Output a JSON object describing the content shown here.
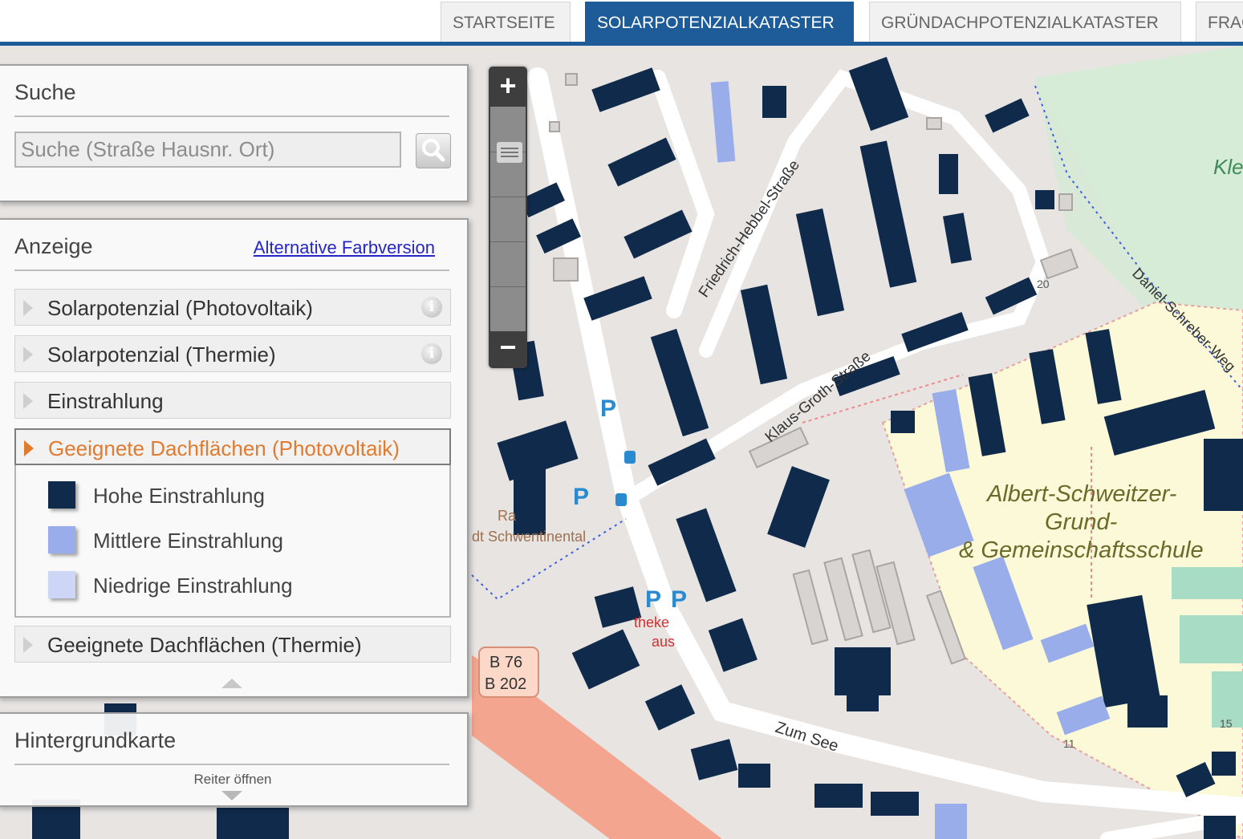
{
  "nav": {
    "tabs": [
      {
        "label": "STARTSEITE",
        "active": false
      },
      {
        "label": "SOLARPOTENZIALKATASTER",
        "active": true
      },
      {
        "label": "GRÜNDACHPOTENZIALKATASTER",
        "active": false
      },
      {
        "label": "FRAGEN",
        "active": false
      }
    ]
  },
  "search": {
    "title": "Suche",
    "placeholder": "Suche (Straße Hausnr. Ort)",
    "button_icon": "magnifier-icon"
  },
  "display": {
    "title": "Anzeige",
    "alt_color_link": "Alternative Farbversion",
    "layers": [
      {
        "label": "Solarpotenzial (Photovoltaik)",
        "info": true,
        "open": false
      },
      {
        "label": "Solarpotenzial (Thermie)",
        "info": true,
        "open": false
      },
      {
        "label": "Einstrahlung",
        "info": false,
        "open": false
      },
      {
        "label": "Geeignete Dachflächen (Photovoltaik)",
        "info": false,
        "open": true
      },
      {
        "label": "Geeignete Dachflächen (Thermie)",
        "info": false,
        "open": false
      }
    ],
    "legend": [
      {
        "label": "Hohe Einstrahlung",
        "color": "#0f2a4a"
      },
      {
        "label": "Mittlere Einstrahlung",
        "color": "#9aadeb"
      },
      {
        "label": "Niedrige Einstrahlung",
        "color": "#cdd6f7"
      }
    ]
  },
  "basemap": {
    "title": "Hintergrundkarte",
    "open_tab": "Reiter öffnen"
  },
  "zoom": {
    "plus": "+",
    "minus": "−"
  },
  "map_labels": {
    "streets": [
      "Friedrich-Hebbel-Straße",
      "Klaus-Groth-Straße",
      "Daniel-Schreber-Weg",
      "Zum See"
    ],
    "school_line1": "Albert-Schweitzer-",
    "school_line2": "Grund-",
    "school_line3": "& Gemeinschaftsschule",
    "kle": "Kle",
    "road_b76": "B 76",
    "road_b202": "B 202",
    "rathaus_a": "Ra",
    "rathaus_b": "dt Schwentinental",
    "apotheke_a": "theke",
    "apotheke_b": "aus",
    "parking": "P",
    "hnr_20": "20",
    "hnr_15": "15",
    "hnr_11": "11"
  },
  "colors": {
    "brand": "#1d5c98",
    "accent": "#e07b2f",
    "roof_high": "#0f2a4a",
    "roof_mid": "#9aadeb",
    "roof_low": "#cdd6f7",
    "school_area": "#fbf9d8",
    "park": "#d6ecd6",
    "main_road": "#f3a58f"
  }
}
